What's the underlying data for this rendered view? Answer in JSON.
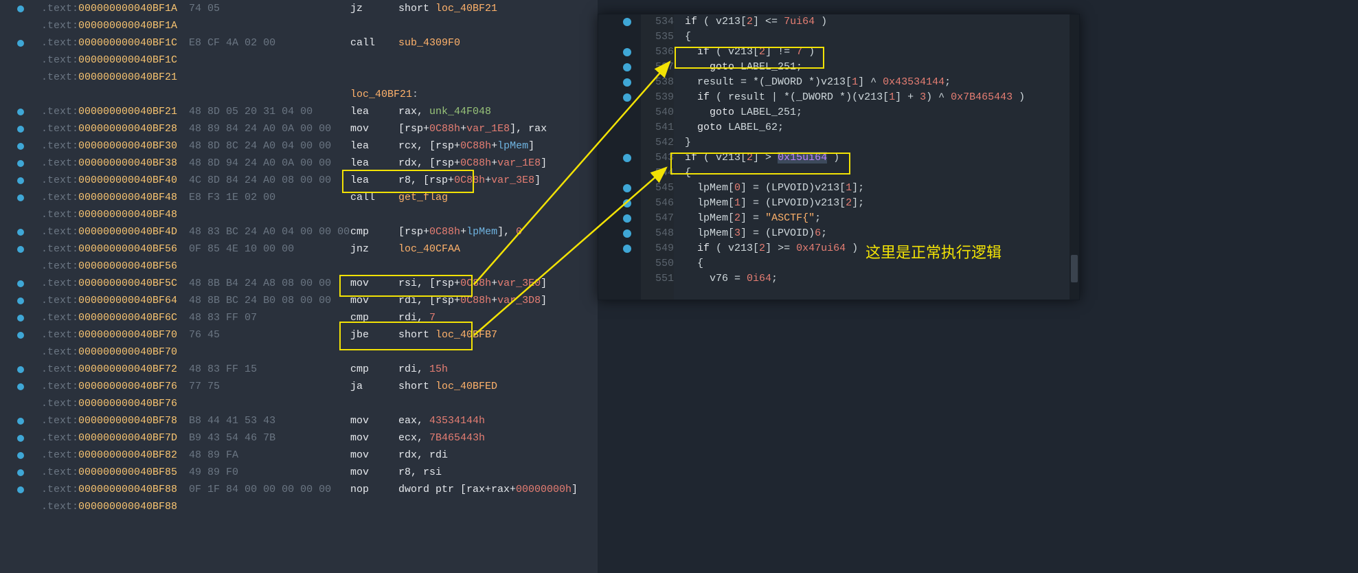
{
  "left": {
    "lines": [
      {
        "bp": true,
        "addr": "000000000040BF1A",
        "bytes": "74 05",
        "mn": "jz",
        "ops": [
          {
            "t": "short ",
            "c": "op-white"
          },
          {
            "t": "loc_40BF21",
            "c": "op-id"
          }
        ]
      },
      {
        "bp": false,
        "addr": "000000000040BF1A",
        "bytes": "",
        "mn": "",
        "ops": []
      },
      {
        "bp": true,
        "addr": "000000000040BF1C",
        "bytes": "E8 CF 4A 02 00",
        "mn": "call",
        "ops": [
          {
            "t": "sub_4309F0",
            "c": "op-id"
          }
        ]
      },
      {
        "bp": false,
        "addr": "000000000040BF1C",
        "bytes": "",
        "mn": "",
        "ops": []
      },
      {
        "bp": false,
        "addr": "000000000040BF21",
        "bytes": "",
        "mn": "",
        "ops": []
      },
      {
        "bp": false,
        "addr": "",
        "bytes": "",
        "mn": "",
        "ops": [],
        "label": "loc_40BF21"
      },
      {
        "bp": true,
        "addr": "000000000040BF21",
        "bytes": "48 8D 05 20 31 04 00",
        "mn": "lea",
        "ops": [
          {
            "t": "rax",
            "c": "op-white"
          },
          {
            "t": ", ",
            "c": "op-white"
          },
          {
            "t": "unk_44F048",
            "c": "op-green"
          }
        ]
      },
      {
        "bp": true,
        "addr": "000000000040BF28",
        "bytes": "48 89 84 24 A0 0A 00 00",
        "mn": "mov",
        "ops": [
          {
            "t": "[",
            "c": "op-white"
          },
          {
            "t": "rsp",
            "c": "op-white"
          },
          {
            "t": "+",
            "c": "op-white"
          },
          {
            "t": "0C88h",
            "c": "op-red"
          },
          {
            "t": "+",
            "c": "op-white"
          },
          {
            "t": "var_1E8",
            "c": "op-red"
          },
          {
            "t": "]",
            "c": "op-white"
          },
          {
            "t": ", rax",
            "c": "op-white"
          }
        ]
      },
      {
        "bp": true,
        "addr": "000000000040BF30",
        "bytes": "48 8D 8C 24 A0 04 00 00",
        "mn": "lea",
        "ops": [
          {
            "t": "rcx",
            "c": "op-white"
          },
          {
            "t": ", [",
            "c": "op-white"
          },
          {
            "t": "rsp",
            "c": "op-white"
          },
          {
            "t": "+",
            "c": "op-white"
          },
          {
            "t": "0C88h",
            "c": "op-red"
          },
          {
            "t": "+",
            "c": "op-white"
          },
          {
            "t": "lpMem",
            "c": "op-blue"
          },
          {
            "t": "]",
            "c": "op-white"
          }
        ]
      },
      {
        "bp": true,
        "addr": "000000000040BF38",
        "bytes": "48 8D 94 24 A0 0A 00 00",
        "mn": "lea",
        "ops": [
          {
            "t": "rdx",
            "c": "op-white"
          },
          {
            "t": ", [",
            "c": "op-white"
          },
          {
            "t": "rsp",
            "c": "op-white"
          },
          {
            "t": "+",
            "c": "op-white"
          },
          {
            "t": "0C88h",
            "c": "op-red"
          },
          {
            "t": "+",
            "c": "op-white"
          },
          {
            "t": "var_1E8",
            "c": "op-red"
          },
          {
            "t": "]",
            "c": "op-white"
          }
        ]
      },
      {
        "bp": true,
        "addr": "000000000040BF40",
        "bytes": "4C 8D 84 24 A0 08 00 00",
        "mn": "lea",
        "ops": [
          {
            "t": "r8",
            "c": "op-white"
          },
          {
            "t": ", [",
            "c": "op-white"
          },
          {
            "t": "rsp",
            "c": "op-white"
          },
          {
            "t": "+",
            "c": "op-white"
          },
          {
            "t": "0C88h",
            "c": "op-red"
          },
          {
            "t": "+",
            "c": "op-white"
          },
          {
            "t": "var_3E8",
            "c": "op-red"
          },
          {
            "t": "]",
            "c": "op-white"
          }
        ]
      },
      {
        "bp": true,
        "addr": "000000000040BF48",
        "bytes": "E8 F3 1E 02 00",
        "mn": "call",
        "ops": [
          {
            "t": "get_flag",
            "c": "op-id"
          }
        ]
      },
      {
        "bp": false,
        "addr": "000000000040BF48",
        "bytes": "",
        "mn": "",
        "ops": []
      },
      {
        "bp": true,
        "addr": "000000000040BF4D",
        "bytes": "48 83 BC 24 A0 04 00 00 00",
        "mn": "cmp",
        "ops": [
          {
            "t": "[",
            "c": "op-white"
          },
          {
            "t": "rsp",
            "c": "op-white"
          },
          {
            "t": "+",
            "c": "op-white"
          },
          {
            "t": "0C88h",
            "c": "op-red"
          },
          {
            "t": "+",
            "c": "op-white"
          },
          {
            "t": "lpMem",
            "c": "op-blue"
          },
          {
            "t": "], ",
            "c": "op-white"
          },
          {
            "t": "0",
            "c": "op-red"
          }
        ]
      },
      {
        "bp": true,
        "addr": "000000000040BF56",
        "bytes": "0F 85 4E 10 00 00",
        "mn": "jnz",
        "ops": [
          {
            "t": "loc_40CFAA",
            "c": "op-id"
          }
        ]
      },
      {
        "bp": false,
        "addr": "000000000040BF56",
        "bytes": "",
        "mn": "",
        "ops": []
      },
      {
        "bp": true,
        "addr": "000000000040BF5C",
        "bytes": "48 8B B4 24 A8 08 00 00",
        "mn": "mov",
        "ops": [
          {
            "t": "rsi",
            "c": "op-white"
          },
          {
            "t": ", [",
            "c": "op-white"
          },
          {
            "t": "rsp",
            "c": "op-white"
          },
          {
            "t": "+",
            "c": "op-white"
          },
          {
            "t": "0C88h",
            "c": "op-red"
          },
          {
            "t": "+",
            "c": "op-white"
          },
          {
            "t": "var_3E0",
            "c": "op-red"
          },
          {
            "t": "]",
            "c": "op-white"
          }
        ]
      },
      {
        "bp": true,
        "addr": "000000000040BF64",
        "bytes": "48 8B BC 24 B0 08 00 00",
        "mn": "mov",
        "ops": [
          {
            "t": "rdi",
            "c": "op-white"
          },
          {
            "t": ", [",
            "c": "op-white"
          },
          {
            "t": "rsp",
            "c": "op-white"
          },
          {
            "t": "+",
            "c": "op-white"
          },
          {
            "t": "0C88h",
            "c": "op-red"
          },
          {
            "t": "+",
            "c": "op-white"
          },
          {
            "t": "var_3D8",
            "c": "op-red"
          },
          {
            "t": "]",
            "c": "op-white"
          }
        ]
      },
      {
        "bp": true,
        "addr": "000000000040BF6C",
        "bytes": "48 83 FF 07",
        "mn": "cmp",
        "ops": [
          {
            "t": "rdi",
            "c": "op-white"
          },
          {
            "t": ", ",
            "c": "op-white"
          },
          {
            "t": "7",
            "c": "op-red"
          }
        ]
      },
      {
        "bp": true,
        "addr": "000000000040BF70",
        "bytes": "76 45",
        "mn": "jbe",
        "ops": [
          {
            "t": "short",
            "c": "op-white"
          },
          {
            "t": " loc_40BFB7",
            "c": "op-id"
          }
        ]
      },
      {
        "bp": false,
        "addr": "000000000040BF70",
        "bytes": "",
        "mn": "",
        "ops": []
      },
      {
        "bp": true,
        "addr": "000000000040BF72",
        "bytes": "48 83 FF 15",
        "mn": "cmp",
        "ops": [
          {
            "t": "rdi",
            "c": "op-white"
          },
          {
            "t": ", ",
            "c": "op-white"
          },
          {
            "t": "15h",
            "c": "op-red"
          }
        ]
      },
      {
        "bp": true,
        "addr": "000000000040BF76",
        "bytes": "77 75",
        "mn": "ja",
        "ops": [
          {
            "t": "short",
            "c": "op-white"
          },
          {
            "t": " loc_40BFED",
            "c": "op-id"
          }
        ]
      },
      {
        "bp": false,
        "addr": "000000000040BF76",
        "bytes": "",
        "mn": "",
        "ops": []
      },
      {
        "bp": true,
        "addr": "000000000040BF78",
        "bytes": "B8 44 41 53 43",
        "mn": "mov",
        "ops": [
          {
            "t": "eax",
            "c": "op-white"
          },
          {
            "t": ", ",
            "c": "op-white"
          },
          {
            "t": "43534144h",
            "c": "op-red"
          }
        ]
      },
      {
        "bp": true,
        "addr": "000000000040BF7D",
        "bytes": "B9 43 54 46 7B",
        "mn": "mov",
        "ops": [
          {
            "t": "ecx",
            "c": "op-white"
          },
          {
            "t": ", ",
            "c": "op-white"
          },
          {
            "t": "7B465443h",
            "c": "op-red"
          }
        ]
      },
      {
        "bp": true,
        "addr": "000000000040BF82",
        "bytes": "48 89 FA",
        "mn": "mov",
        "ops": [
          {
            "t": "rdx",
            "c": "op-white"
          },
          {
            "t": ", rdi",
            "c": "op-white"
          }
        ]
      },
      {
        "bp": true,
        "addr": "000000000040BF85",
        "bytes": "49 89 F0",
        "mn": "mov",
        "ops": [
          {
            "t": "r8",
            "c": "op-white"
          },
          {
            "t": ", rsi",
            "c": "op-white"
          }
        ]
      },
      {
        "bp": true,
        "addr": "000000000040BF88",
        "bytes": "0F 1F 84 00 00 00 00 00",
        "mn": "nop",
        "ops": [
          {
            "t": "dword ptr [rax+rax+",
            "c": "op-white"
          },
          {
            "t": "00000000h",
            "c": "op-red"
          },
          {
            "t": "]",
            "c": "op-white"
          }
        ]
      },
      {
        "bp": false,
        "addr": "000000000040BF88",
        "bytes": "",
        "mn": "",
        "ops": []
      }
    ]
  },
  "right": {
    "lines": [
      {
        "bp": true,
        "ln": "534",
        "code": [
          {
            "t": "if",
            "c": "rkw"
          },
          {
            "t": " ( v213[",
            "c": "rwh"
          },
          {
            "t": "2",
            "c": "rnum"
          },
          {
            "t": "] <= ",
            "c": "rwh"
          },
          {
            "t": "7ui64",
            "c": "rnum"
          },
          {
            "t": " )",
            "c": "rwh"
          }
        ],
        "ind": 0
      },
      {
        "bp": false,
        "ln": "535",
        "code": [
          {
            "t": "{",
            "c": "rwh"
          }
        ],
        "ind": 0
      },
      {
        "bp": true,
        "ln": "536",
        "code": [
          {
            "t": "if",
            "c": "rkw"
          },
          {
            "t": " ( v213[",
            "c": "rwh"
          },
          {
            "t": "2",
            "c": "rnum"
          },
          {
            "t": "] != ",
            "c": "rwh"
          },
          {
            "t": "7",
            "c": "rnum"
          },
          {
            "t": " )",
            "c": "rwh"
          }
        ],
        "ind": 1
      },
      {
        "bp": true,
        "ln": "537",
        "code": [
          {
            "t": "goto",
            "c": "rkw"
          },
          {
            "t": " LABEL_251;",
            "c": "rwh"
          }
        ],
        "ind": 2
      },
      {
        "bp": true,
        "ln": "538",
        "code": [
          {
            "t": "result = *(_DWORD *)v213[",
            "c": "rwh"
          },
          {
            "t": "1",
            "c": "rnum"
          },
          {
            "t": "] ^ ",
            "c": "rwh"
          },
          {
            "t": "0x43534144",
            "c": "rnum"
          },
          {
            "t": ";",
            "c": "rwh"
          }
        ],
        "ind": 1
      },
      {
        "bp": true,
        "ln": "539",
        "code": [
          {
            "t": "if",
            "c": "rkw"
          },
          {
            "t": " ( result | *(_DWORD *)(v213[",
            "c": "rwh"
          },
          {
            "t": "1",
            "c": "rnum"
          },
          {
            "t": "] + ",
            "c": "rwh"
          },
          {
            "t": "3",
            "c": "rnum"
          },
          {
            "t": ") ^ ",
            "c": "rwh"
          },
          {
            "t": "0x7B465443",
            "c": "rnum"
          },
          {
            "t": " )",
            "c": "rwh"
          }
        ],
        "ind": 1
      },
      {
        "bp": false,
        "ln": "540",
        "code": [
          {
            "t": "goto",
            "c": "rkw"
          },
          {
            "t": " LABEL_251;",
            "c": "rwh"
          }
        ],
        "ind": 2
      },
      {
        "bp": false,
        "ln": "541",
        "code": [
          {
            "t": "goto",
            "c": "rkw"
          },
          {
            "t": " LABEL_62;",
            "c": "rwh"
          }
        ],
        "ind": 1
      },
      {
        "bp": false,
        "ln": "542",
        "code": [
          {
            "t": "}",
            "c": "rwh"
          }
        ],
        "ind": 0
      },
      {
        "bp": true,
        "ln": "543",
        "code": [
          {
            "t": "if",
            "c": "rkw"
          },
          {
            "t": " ( v213[",
            "c": "rwh"
          },
          {
            "t": "2",
            "c": "rnum"
          },
          {
            "t": "] > ",
            "c": "rwh"
          },
          {
            "t": "0x15ui64",
            "c": "rhex",
            "sel": true
          },
          {
            "t": " )",
            "c": "rwh"
          }
        ],
        "ind": 0
      },
      {
        "bp": false,
        "ln": "544",
        "code": [
          {
            "t": "{",
            "c": "rwh"
          }
        ],
        "ind": 0
      },
      {
        "bp": true,
        "ln": "545",
        "code": [
          {
            "t": "lpMem[",
            "c": "rwh"
          },
          {
            "t": "0",
            "c": "rnum"
          },
          {
            "t": "] = (LPVOID)v213[",
            "c": "rwh"
          },
          {
            "t": "1",
            "c": "rnum"
          },
          {
            "t": "];",
            "c": "rwh"
          }
        ],
        "ind": 1
      },
      {
        "bp": true,
        "ln": "546",
        "code": [
          {
            "t": "lpMem[",
            "c": "rwh"
          },
          {
            "t": "1",
            "c": "rnum"
          },
          {
            "t": "] = (LPVOID)v213[",
            "c": "rwh"
          },
          {
            "t": "2",
            "c": "rnum"
          },
          {
            "t": "];",
            "c": "rwh"
          }
        ],
        "ind": 1
      },
      {
        "bp": true,
        "ln": "547",
        "code": [
          {
            "t": "lpMem[",
            "c": "rwh"
          },
          {
            "t": "2",
            "c": "rnum"
          },
          {
            "t": "] = ",
            "c": "rwh"
          },
          {
            "t": "\"ASCTF{\"",
            "c": "rstr"
          },
          {
            "t": ";",
            "c": "rwh"
          }
        ],
        "ind": 1
      },
      {
        "bp": true,
        "ln": "548",
        "code": [
          {
            "t": "lpMem[",
            "c": "rwh"
          },
          {
            "t": "3",
            "c": "rnum"
          },
          {
            "t": "] = (LPVOID)",
            "c": "rwh"
          },
          {
            "t": "6",
            "c": "rnum"
          },
          {
            "t": ";",
            "c": "rwh"
          }
        ],
        "ind": 1
      },
      {
        "bp": true,
        "ln": "549",
        "code": [
          {
            "t": "if",
            "c": "rkw"
          },
          {
            "t": " ( v213[",
            "c": "rwh"
          },
          {
            "t": "2",
            "c": "rnum"
          },
          {
            "t": "] >= ",
            "c": "rwh"
          },
          {
            "t": "0x47ui64",
            "c": "rnum"
          },
          {
            "t": " )",
            "c": "rwh"
          }
        ],
        "ind": 1
      },
      {
        "bp": false,
        "ln": "550",
        "code": [
          {
            "t": "{",
            "c": "rwh"
          }
        ],
        "ind": 1
      },
      {
        "bp": false,
        "ln": "551",
        "code": [
          {
            "t": "v76 = ",
            "c": "rwh"
          },
          {
            "t": "0i64",
            "c": "rnum"
          },
          {
            "t": ";",
            "c": "rwh"
          }
        ],
        "ind": 2
      }
    ]
  },
  "annotation": "这里是正常执行逻辑"
}
